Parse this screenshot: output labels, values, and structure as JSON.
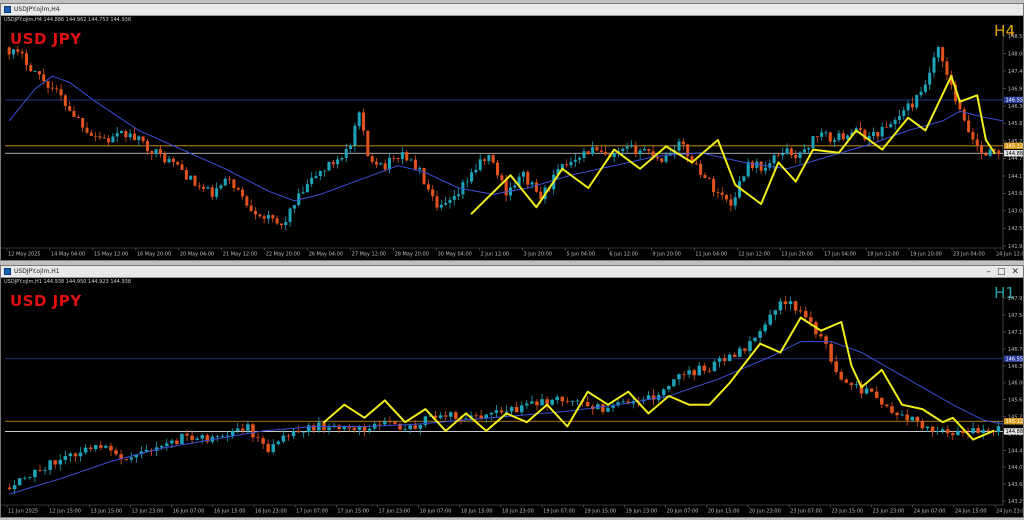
{
  "colors": {
    "background": "#000000",
    "bull": "#1fa3b8",
    "bear": "#e0521e",
    "ma": "#3b4fd4",
    "annotation": "#f2ee1a",
    "level_blue": "#2c3f9e",
    "level_orange": "#d99c1e",
    "level_white": "#e6e6e6",
    "symbol": "#e01010",
    "h4_tf": "#e8a800",
    "h1_tf": "#2aa0a8"
  },
  "windows": [
    {
      "title": "USDJPY.ojlm,H4",
      "info": "USDJPY.ojlm,H4  144.886 144.962 144.753 144.938",
      "symbol_label": "USD JPY",
      "timeframe_label": "H4",
      "price_axis": {
        "ticks": [
          "148.555",
          "148.005",
          "147.460",
          "146.910",
          "146.365",
          "145.820",
          "145.270",
          "144.725",
          "144.175",
          "143.630",
          "143.085",
          "142.535",
          "141.985"
        ],
        "ymin": 141.985,
        "ymax": 148.555
      },
      "levels": [
        {
          "kind": "blue",
          "value": 146.555,
          "label": "146.555"
        },
        {
          "kind": "orange",
          "value": 145.12,
          "label": "145.120"
        },
        {
          "kind": "white",
          "value": 144.887,
          "label": "144.887"
        }
      ],
      "time_axis": [
        "12 May 2025",
        "14 May 04:00",
        "15 May 12:00",
        "16 May 20:00",
        "20 May 04:00",
        "21 May 12:00",
        "22 May 20:00",
        "26 May 04:00",
        "27 May 12:00",
        "28 May 20:00",
        "30 May 04:00",
        "2 Jun 12:00",
        "3 Jun 20:00",
        "5 Jun 04:00",
        "6 Jun 12:00",
        "9 Jun 20:00",
        "11 Jun 04:00",
        "12 Jun 12:00",
        "13 Jun 20:00",
        "17 Jun 04:00",
        "18 Jun 12:00",
        "19 Jun 20:00",
        "23 Jun 04:00",
        "24 Jun 12:00"
      ],
      "chart_data": {
        "type": "candlestick",
        "anchors": [
          [
            0,
            148.2
          ],
          [
            4,
            147.9
          ],
          [
            8,
            147.3
          ],
          [
            12,
            146.8
          ],
          [
            16,
            146.1
          ],
          [
            20,
            145.5
          ],
          [
            24,
            145.3
          ],
          [
            28,
            145.5
          ],
          [
            32,
            145.2
          ],
          [
            36,
            144.8
          ],
          [
            40,
            144.5
          ],
          [
            44,
            143.9
          ],
          [
            48,
            143.6
          ],
          [
            52,
            144.1
          ],
          [
            56,
            143.3
          ],
          [
            60,
            142.9
          ],
          [
            64,
            142.6
          ],
          [
            68,
            143.5
          ],
          [
            72,
            144.2
          ],
          [
            76,
            144.6
          ],
          [
            80,
            145.1
          ],
          [
            82,
            146.1
          ],
          [
            84,
            144.8
          ],
          [
            88,
            144.5
          ],
          [
            92,
            144.9
          ],
          [
            96,
            144.3
          ],
          [
            100,
            143.1
          ],
          [
            104,
            143.4
          ],
          [
            108,
            144.3
          ],
          [
            112,
            144.8
          ],
          [
            116,
            143.7
          ],
          [
            120,
            144.2
          ],
          [
            124,
            143.5
          ],
          [
            128,
            144.3
          ],
          [
            132,
            144.8
          ],
          [
            136,
            145.0
          ],
          [
            140,
            144.7
          ],
          [
            144,
            145.0
          ],
          [
            148,
            145.0
          ],
          [
            152,
            144.7
          ],
          [
            156,
            145.2
          ],
          [
            160,
            144.5
          ],
          [
            164,
            143.8
          ],
          [
            168,
            143.3
          ],
          [
            172,
            144.6
          ],
          [
            176,
            144.4
          ],
          [
            180,
            145.0
          ],
          [
            184,
            144.8
          ],
          [
            188,
            145.5
          ],
          [
            192,
            145.3
          ],
          [
            196,
            145.6
          ],
          [
            200,
            145.4
          ],
          [
            204,
            145.7
          ],
          [
            208,
            146.2
          ],
          [
            212,
            146.7
          ],
          [
            214,
            147.4
          ],
          [
            216,
            148.1
          ],
          [
            218,
            147.3
          ],
          [
            222,
            145.8
          ],
          [
            226,
            144.9
          ],
          [
            228,
            144.94
          ]
        ],
        "ma_anchors": [
          [
            0,
            145.9
          ],
          [
            6,
            146.9
          ],
          [
            10,
            147.3
          ],
          [
            14,
            147.1
          ],
          [
            20,
            146.5
          ],
          [
            30,
            145.6
          ],
          [
            40,
            145.0
          ],
          [
            50,
            144.4
          ],
          [
            60,
            143.7
          ],
          [
            66,
            143.4
          ],
          [
            72,
            143.6
          ],
          [
            78,
            143.9
          ],
          [
            84,
            144.2
          ],
          [
            90,
            144.5
          ],
          [
            96,
            144.3
          ],
          [
            104,
            143.8
          ],
          [
            112,
            143.6
          ],
          [
            120,
            143.8
          ],
          [
            130,
            144.2
          ],
          [
            140,
            144.5
          ],
          [
            150,
            144.8
          ],
          [
            160,
            144.9
          ],
          [
            170,
            144.6
          ],
          [
            180,
            144.4
          ],
          [
            190,
            144.8
          ],
          [
            200,
            145.2
          ],
          [
            208,
            145.6
          ],
          [
            216,
            145.9
          ],
          [
            220,
            146.2
          ],
          [
            226,
            146.0
          ],
          [
            230,
            145.9
          ]
        ],
        "zigzag": [
          [
            107,
            143.0
          ],
          [
            116,
            144.2
          ],
          [
            122,
            143.2
          ],
          [
            128,
            144.4
          ],
          [
            134,
            143.8
          ],
          [
            140,
            145.0
          ],
          [
            146,
            144.4
          ],
          [
            152,
            145.1
          ],
          [
            158,
            144.6
          ],
          [
            164,
            145.3
          ],
          [
            168,
            143.9
          ],
          [
            174,
            143.3
          ],
          [
            178,
            144.6
          ],
          [
            182,
            144.0
          ],
          [
            186,
            145.0
          ],
          [
            192,
            144.9
          ],
          [
            196,
            145.6
          ],
          [
            202,
            145.0
          ],
          [
            208,
            146.0
          ],
          [
            212,
            145.6
          ],
          [
            218,
            147.3
          ],
          [
            220,
            146.5
          ],
          [
            224,
            146.7
          ],
          [
            226,
            145.3
          ],
          [
            228,
            144.9
          ]
        ],
        "n_bars": 230
      }
    },
    {
      "title": "USDJPY.ojlm,H1",
      "info": "USDJPY.ojlm,H1  144.938 144.950 144.923 144.938",
      "symbol_label": "USD JPY",
      "timeframe_label": "H1",
      "price_axis": {
        "ticks": [
          "147.950",
          "147.560",
          "147.170",
          "146.780",
          "146.390",
          "146.000",
          "145.620",
          "145.230",
          "144.840",
          "144.450",
          "144.070",
          "143.680",
          "143.290"
        ],
        "ymin": 143.29,
        "ymax": 147.95
      },
      "levels": [
        {
          "kind": "blue",
          "value": 146.555,
          "label": "146.555"
        },
        {
          "kind": "orange",
          "value": 145.12,
          "label": "145.120"
        },
        {
          "kind": "white",
          "value": 144.887,
          "label": "144.887"
        }
      ],
      "time_axis": [
        "11 Jun 2025",
        "12 Jun 15:00",
        "13 Jun 15:00",
        "13 Jun 23:00",
        "16 Jun 07:00",
        "16 Jun 15:00",
        "16 Jun 23:00",
        "17 Jun 07:00",
        "17 Jun 15:00",
        "17 Jun 23:00",
        "18 Jun 07:00",
        "18 Jun 15:00",
        "18 Jun 23:00",
        "19 Jun 07:00",
        "19 Jun 15:00",
        "19 Jun 23:00",
        "20 Jun 07:00",
        "20 Jun 15:00",
        "20 Jun 23:00",
        "23 Jun 07:00",
        "23 Jun 15:00",
        "23 Jun 23:00",
        "24 Jun 07:00",
        "24 Jun 15:00",
        "24 Jun 23:00"
      ],
      "chart_data": {
        "type": "candlestick",
        "anchors": [
          [
            0,
            143.6
          ],
          [
            6,
            144.0
          ],
          [
            12,
            144.3
          ],
          [
            18,
            144.6
          ],
          [
            24,
            144.2
          ],
          [
            30,
            144.5
          ],
          [
            36,
            144.8
          ],
          [
            42,
            144.7
          ],
          [
            48,
            145.0
          ],
          [
            52,
            144.4
          ],
          [
            56,
            144.8
          ],
          [
            62,
            145.0
          ],
          [
            68,
            144.9
          ],
          [
            74,
            145.1
          ],
          [
            80,
            145.0
          ],
          [
            86,
            145.3
          ],
          [
            92,
            145.2
          ],
          [
            98,
            145.3
          ],
          [
            104,
            145.5
          ],
          [
            110,
            145.6
          ],
          [
            116,
            145.4
          ],
          [
            122,
            145.5
          ],
          [
            128,
            145.7
          ],
          [
            134,
            146.2
          ],
          [
            140,
            146.4
          ],
          [
            146,
            146.8
          ],
          [
            150,
            147.4
          ],
          [
            154,
            147.9
          ],
          [
            158,
            147.5
          ],
          [
            162,
            146.9
          ],
          [
            164,
            146.2
          ],
          [
            168,
            145.9
          ],
          [
            172,
            145.7
          ],
          [
            176,
            145.3
          ],
          [
            180,
            145.1
          ],
          [
            186,
            144.8
          ],
          [
            190,
            144.9
          ],
          [
            194,
            144.94
          ]
        ],
        "ma_anchors": [
          [
            0,
            143.45
          ],
          [
            10,
            143.8
          ],
          [
            20,
            144.2
          ],
          [
            30,
            144.5
          ],
          [
            40,
            144.7
          ],
          [
            50,
            144.9
          ],
          [
            60,
            145.0
          ],
          [
            70,
            145.0
          ],
          [
            80,
            145.05
          ],
          [
            90,
            145.15
          ],
          [
            100,
            145.25
          ],
          [
            110,
            145.35
          ],
          [
            120,
            145.5
          ],
          [
            130,
            145.7
          ],
          [
            140,
            146.1
          ],
          [
            150,
            146.6
          ],
          [
            156,
            146.95
          ],
          [
            162,
            146.95
          ],
          [
            168,
            146.7
          ],
          [
            174,
            146.3
          ],
          [
            180,
            145.9
          ],
          [
            186,
            145.5
          ],
          [
            192,
            145.15
          ],
          [
            196,
            145.05
          ]
        ],
        "zigzag": [
          [
            62,
            145.1
          ],
          [
            66,
            145.5
          ],
          [
            70,
            145.2
          ],
          [
            74,
            145.6
          ],
          [
            78,
            145.1
          ],
          [
            82,
            145.4
          ],
          [
            86,
            144.9
          ],
          [
            90,
            145.3
          ],
          [
            94,
            144.9
          ],
          [
            98,
            145.3
          ],
          [
            102,
            145.1
          ],
          [
            106,
            145.5
          ],
          [
            110,
            145.0
          ],
          [
            114,
            145.8
          ],
          [
            118,
            145.5
          ],
          [
            122,
            145.8
          ],
          [
            126,
            145.3
          ],
          [
            130,
            145.7
          ],
          [
            134,
            145.5
          ],
          [
            138,
            145.5
          ],
          [
            142,
            146.0
          ],
          [
            148,
            146.9
          ],
          [
            152,
            146.7
          ],
          [
            156,
            147.5
          ],
          [
            160,
            147.2
          ],
          [
            164,
            147.4
          ],
          [
            166,
            146.4
          ],
          [
            168,
            145.9
          ],
          [
            172,
            146.3
          ],
          [
            176,
            145.5
          ],
          [
            180,
            145.4
          ],
          [
            184,
            145.1
          ],
          [
            186,
            145.2
          ],
          [
            190,
            144.7
          ],
          [
            194,
            144.9
          ]
        ],
        "n_bars": 196
      }
    }
  ]
}
